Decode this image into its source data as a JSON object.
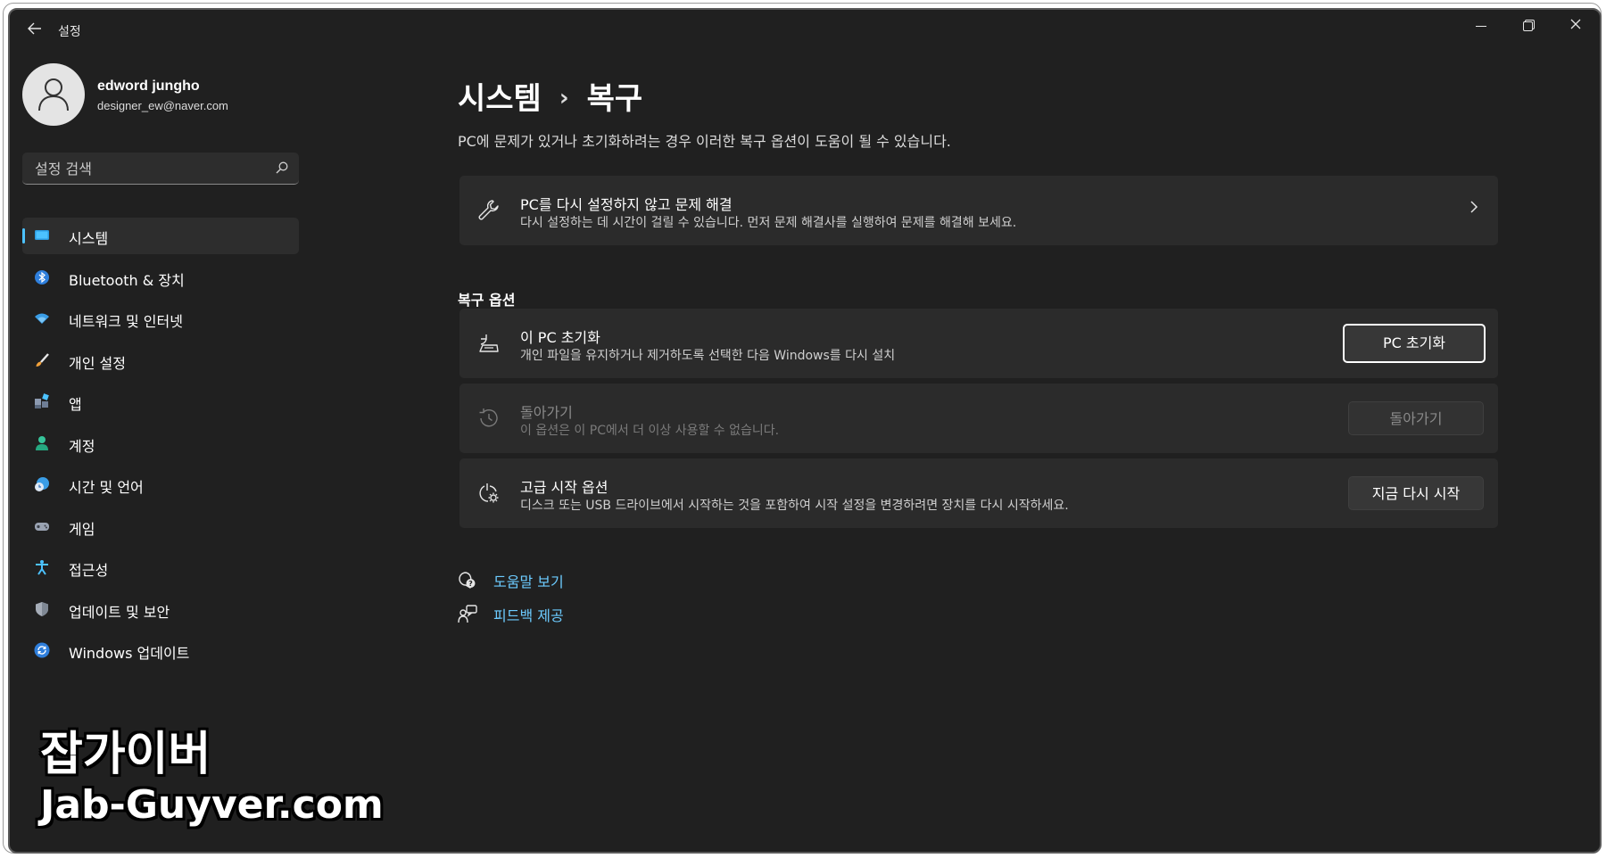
{
  "window": {
    "title": "설정"
  },
  "profile": {
    "name": "edword jungho",
    "email": "designer_ew@naver.com"
  },
  "search": {
    "placeholder": "설정 검색"
  },
  "nav": {
    "items": [
      {
        "label": "시스템",
        "icon": "monitor-icon",
        "active": true
      },
      {
        "label": "Bluetooth & 장치",
        "icon": "bluetooth-icon"
      },
      {
        "label": "네트워크 및 인터넷",
        "icon": "wifi-icon"
      },
      {
        "label": "개인 설정",
        "icon": "paintbrush-icon"
      },
      {
        "label": "앱",
        "icon": "apps-icon"
      },
      {
        "label": "계정",
        "icon": "account-icon"
      },
      {
        "label": "시간 및 언어",
        "icon": "globe-clock-icon"
      },
      {
        "label": "게임",
        "icon": "gamepad-icon"
      },
      {
        "label": "접근성",
        "icon": "accessibility-icon"
      },
      {
        "label": "업데이트 및 보안",
        "icon": "shield-icon"
      },
      {
        "label": "Windows 업데이트",
        "icon": "sync-icon"
      }
    ]
  },
  "breadcrumb": {
    "parent": "시스템",
    "separator": "›",
    "current": "복구"
  },
  "page": {
    "description": "PC에 문제가 있거나 초기화하려는 경우 이러한 복구 옵션이 도움이 될 수 있습니다."
  },
  "troubleshoot": {
    "title": "PC를 다시 설정하지 않고 문제 해결",
    "subtitle": "다시 설정하는 데 시간이 걸릴 수 있습니다. 먼저 문제 해결사를 실행하여 문제를 해결해 보세요.",
    "icon": "wrench-icon"
  },
  "recovery_options": {
    "title": "복구 옵션",
    "items": [
      {
        "title": "이 PC 초기화",
        "subtitle": "개인 파일을 유지하거나 제거하도록 선택한 다음 Windows를 다시 설치",
        "button": "PC 초기화",
        "icon": "reset-pc-icon",
        "enabled": true
      },
      {
        "title": "돌아가기",
        "subtitle": "이 옵션은 이 PC에서 더 이상 사용할 수 없습니다.",
        "button": "돌아가기",
        "icon": "history-icon",
        "enabled": false
      },
      {
        "title": "고급 시작 옵션",
        "subtitle": "디스크 또는 USB 드라이브에서 시작하는 것을 포함하여 시작 설정을 변경하려면 장치를 다시 시작하세요.",
        "button": "지금 다시 시작",
        "icon": "advanced-startup-icon",
        "enabled": true
      }
    ]
  },
  "links": [
    {
      "label": "도움말 보기",
      "icon": "help-icon"
    },
    {
      "label": "피드백 제공",
      "icon": "feedback-icon"
    }
  ],
  "watermark": {
    "line1": "잡가이버",
    "line2": "Jab-Guyver.com"
  },
  "colors": {
    "background": "#202020",
    "card": "#2b2b2b",
    "accent": "#4cc2ff",
    "link": "#6ccbff"
  }
}
